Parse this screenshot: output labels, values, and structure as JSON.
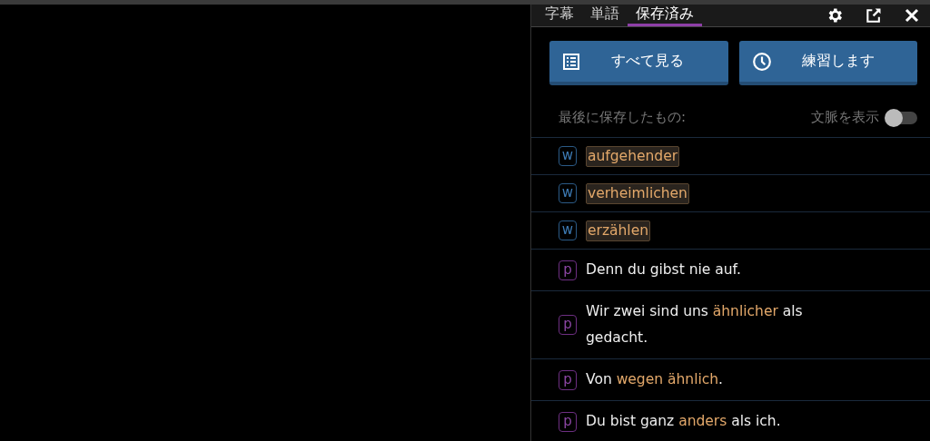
{
  "tabs": [
    {
      "label": "字幕",
      "selected": false
    },
    {
      "label": "単語",
      "selected": false
    },
    {
      "label": "保存済み",
      "selected": true
    }
  ],
  "actions": [
    {
      "kind": "list",
      "label": "すべて見る"
    },
    {
      "kind": "clock",
      "label": "練習します"
    }
  ],
  "recent_label": "最後に保存したもの:",
  "context_toggle": {
    "label": "文脈を表示",
    "on": false
  },
  "items": [
    {
      "kind": "word",
      "badge": "w",
      "parts": [
        {
          "text": "aufgehender",
          "highlight": true
        }
      ]
    },
    {
      "kind": "word",
      "badge": "w",
      "parts": [
        {
          "text": "verheimlichen",
          "highlight": true
        }
      ]
    },
    {
      "kind": "word",
      "badge": "w",
      "parts": [
        {
          "text": "erzählen",
          "highlight": true
        }
      ]
    },
    {
      "kind": "phrase",
      "badge": "p",
      "parts": [
        {
          "text": "Denn du gibst nie auf.",
          "highlight": false
        }
      ]
    },
    {
      "kind": "phrase",
      "badge": "p",
      "parts": [
        {
          "text": "Wir zwei sind uns ",
          "highlight": false
        },
        {
          "text": "ähnlicher",
          "highlight": true
        },
        {
          "text": " als gedacht.",
          "highlight": false
        }
      ]
    },
    {
      "kind": "phrase",
      "badge": "p",
      "parts": [
        {
          "text": "Von ",
          "highlight": false
        },
        {
          "text": "wegen ähnlich",
          "highlight": true
        },
        {
          "text": ".",
          "highlight": false
        }
      ]
    },
    {
      "kind": "phrase",
      "badge": "p",
      "parts": [
        {
          "text": "Du bist ganz ",
          "highlight": false
        },
        {
          "text": "anders",
          "highlight": true
        },
        {
          "text": " als ich.",
          "highlight": false
        }
      ]
    }
  ]
}
